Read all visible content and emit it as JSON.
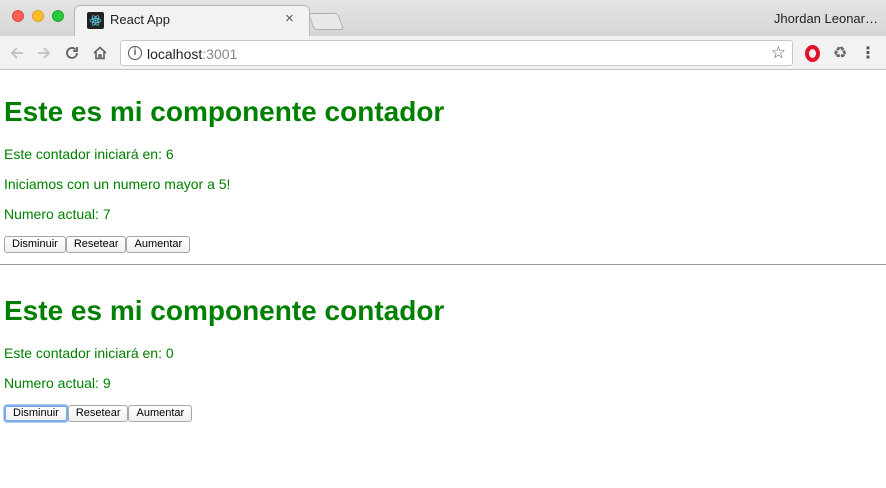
{
  "browser": {
    "tab_title": "React App",
    "tab_close": "×",
    "profile_name": "Jhordan Leonar…",
    "url_host": "localhost",
    "url_port": ":3001",
    "icons": {
      "back": "arrow-left-icon",
      "forward": "arrow-right-icon",
      "reload": "reload-icon",
      "home": "home-icon",
      "info": "info-icon",
      "bookmark": "star-icon",
      "opera": "opera-icon",
      "recycle": "recycle-icon",
      "menu": "kebab-menu-icon"
    }
  },
  "colors": {
    "text_green": "#008000",
    "focus_ring": "#7cabe9"
  },
  "counters": [
    {
      "title": "Este es mi componente contador",
      "start_text": "Este contador iniciará en: 6",
      "extra_text": "Iniciamos con un numero mayor a 5!",
      "current_text": "Numero actual: 7",
      "buttons": {
        "decrease": "Disminuir",
        "reset": "Resetear",
        "increase": "Aumentar"
      }
    },
    {
      "title": "Este es mi componente contador",
      "start_text": "Este contador iniciará en: 0",
      "current_text": "Numero actual: 9",
      "buttons": {
        "decrease": "Disminuir",
        "reset": "Resetear",
        "increase": "Aumentar"
      }
    }
  ]
}
